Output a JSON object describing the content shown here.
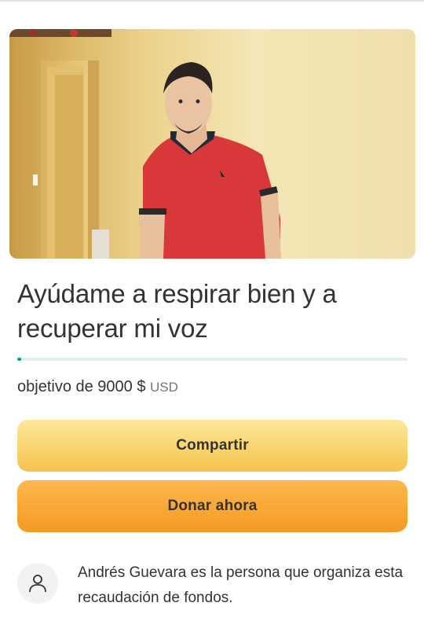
{
  "campaign": {
    "title": "Ayúdame a respirar bien y a recuperar mi voz",
    "progress_fraction": 0.01,
    "goal_text": "objetivo de 9000 $",
    "goal_currency": "USD"
  },
  "buttons": {
    "share_label": "Compartir",
    "donate_label": "Donar ahora"
  },
  "organizer": {
    "text": "Andrés Guevara es la persona que organiza esta recaudación de fondos."
  },
  "icons": {
    "organizer": "person-icon"
  },
  "colors": {
    "progress": "#02a95c",
    "share_button": "#f8d05f",
    "donate_button": "#f7a632"
  }
}
